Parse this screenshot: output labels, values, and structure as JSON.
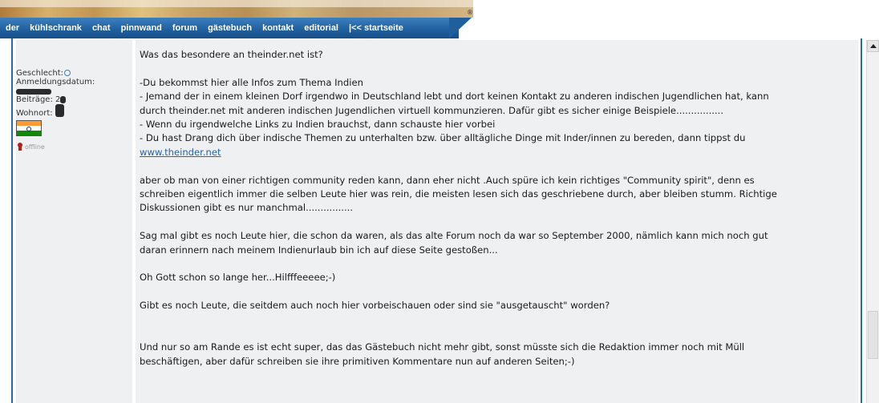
{
  "header": {
    "banner_name": "header-banner-image",
    "nav": [
      "der",
      "kühlschrank",
      "chat",
      "pinnwand",
      "forum",
      "gästebuch",
      "kontakt",
      "editorial",
      "|<< startseite"
    ]
  },
  "profile": {
    "gender_label": "Geschlecht:",
    "registered_label": "Anmeldungsdatum:",
    "posts_label": "Beiträge: 2",
    "location_label": "Wohnort:",
    "status": "offline",
    "flag_colors": [
      "#ff9933",
      "#ffffff",
      "#138808"
    ],
    "icons": [
      "gender-icon",
      "india-flag-icon",
      "offline-status-icon"
    ]
  },
  "post": {
    "lines": [
      "Was das besondere an theinder.net ist?",
      "",
      "-Du bekommst hier alle Infos zum Thema Indien",
      "- Jemand der in einem kleinen Dorf irgendwo in Deutschland lebt und dort keinen Kontakt zu anderen indischen Jugendlichen hat, kann",
      "durch theinder.net mit anderen indischen Jugendlichen virtuell kommunzieren. Dafür gibt es sicher einige Beispiele................",
      "- Wenn du irgendwelche Links zu Indien brauchst, dann schauste hier vorbei",
      "- Du hast Drang dich über indische Themen zu unterhalten bzw. über alltägliche Dinge mit Inder/innen zu bereden, dann tippst du"
    ],
    "link": "www.theinder.net",
    "paragraphs": [
      "aber ob man von einer richtigen community reden kann, dann eher nicht .Auch spüre ich kein richtiges \"Community spirit\", denn es",
      "schreiben eigentlich immer die selben Leute hier was rein, die meisten lesen sich das geschriebene durch, aber bleiben stumm. Richtige",
      "Diskussionen gibt es nur manchmal................",
      "Sag mal gibt es noch Leute hier, die schon da waren, als das alte Forum noch da war so September 2000, nämlich kann mich noch gut",
      "daran erinnern nach meinem Indienurlaub bin ich auf diese Seite gestoßen...",
      "Oh Gott schon so lange her...Hilfffeeeee;-)",
      "Gibt es noch Leute, die seitdem auch noch hier vorbeischauen oder sind sie \"ausgetauscht\" worden?",
      "Und nur so am Rande es ist echt super, das das Gästebuch nicht mehr gibt, sonst müsste sich die Redaktion immer noch mit Müll",
      "beschäftigen, aber dafür schreiben sie ihre primitiven Kommentare nun auf anderen Seiten;-)"
    ]
  },
  "colors": {
    "nav_bg": "#1f5f9e",
    "post_bg": "#eef0f2",
    "link": "#2a64a4",
    "border": "#2d6aa5"
  }
}
